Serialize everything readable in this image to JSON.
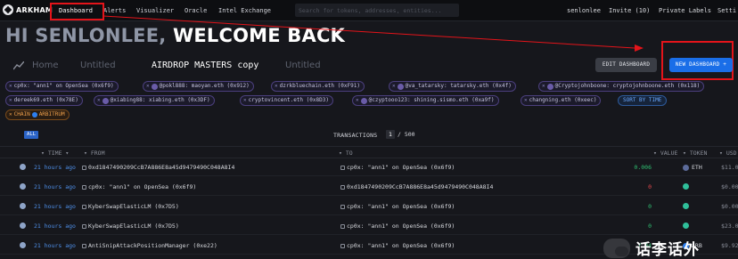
{
  "nav": {
    "logo": "ARKHAM",
    "items": [
      "Dashboard",
      "Alerts",
      "Visualizer",
      "Oracle",
      "Intel Exchange"
    ],
    "search_placeholder": "Search for tokens, addresses, entities...",
    "user": "senlonlee",
    "invite": "Invite (10)",
    "private_labels": "Private Labels",
    "settings": "Setti"
  },
  "welcome": {
    "greeting": "HI SENLONLEE,",
    "message": "WELCOME BACK"
  },
  "tabs": [
    "Home",
    "Untitled",
    "AIRDROP MASTERS copy",
    "Untitled"
  ],
  "buttons": {
    "edit": "EDIT DASHBOARD",
    "new": "NEW DASHBOARD +"
  },
  "filters": [
    "cp0x: \"ann1\" on OpenSea (0x6f9)",
    "@pokl888: maoyan.eth (0x912)",
    "dzrkbluechain.eth (0xF91)",
    "@va_tatarsky: tatarsky.eth (0x4f)",
    "@Cryptojohnboone: cryptojohnboone.eth (0x118)",
    "dereek69.eth (0x78E)",
    "@xiabing88: xiabing.eth (0x3DF)",
    "cryptovincent.eth (0x8D3)",
    "@czyptooo123: shining.sismo.eth (0xa9f)",
    "changning.eth (0xeec)"
  ],
  "sort_label": "SORT BY TIME",
  "chain_filter": "CHAIN",
  "chain_value": "ARBITRUM",
  "table": {
    "all_label": "ALL",
    "transactions_label": "TRANSACTIONS",
    "page": "1",
    "page_total": "/ 500",
    "headers": {
      "time": "TIME",
      "from": "FROM",
      "to": "TO",
      "value": "VALUE",
      "token": "TOKEN",
      "usd": "USD"
    },
    "rows": [
      {
        "time": "21 hours ago",
        "from": "0xd1847490209CcB7A886E8a45d9479490C048A8I4",
        "to": "cp0x: \"ann1\" on OpenSea (0x6f9)",
        "value": "0.006",
        "token": "ETH",
        "usd": "$11.02"
      },
      {
        "time": "21 hours ago",
        "from": "cp0x: \"ann1\" on OpenSea (0x6f9)",
        "to": "0xd1847490209CcB7A886E8a45d9479490C048A8I4",
        "value": "0",
        "token": "",
        "usd": "$0.00"
      },
      {
        "time": "21 hours ago",
        "from": "KyberSwapElasticLM (0x7D5)",
        "to": "cp0x: \"ann1\" on OpenSea (0x6f9)",
        "value": "0",
        "token": "",
        "usd": "$0.00"
      },
      {
        "time": "21 hours ago",
        "from": "KyberSwapElasticLM (0x7D5)",
        "to": "cp0x: \"ann1\" on OpenSea (0x6f9)",
        "value": "0",
        "token": "",
        "usd": "$23.00"
      },
      {
        "time": "21 hours ago",
        "from": "AntiSnipAttackPositionManager (0xe22)",
        "to": "cp0x: \"ann1\" on OpenSea (0x6f9)",
        "value": "7.94",
        "token": "ARB",
        "usd": "$9.92"
      }
    ]
  },
  "watermark": "话李话外",
  "colors": {
    "accent_blue": "#1a6ee8",
    "highlight_red": "#e4141a",
    "value_green": "#2fbf71",
    "value_red": "#e5484d"
  }
}
